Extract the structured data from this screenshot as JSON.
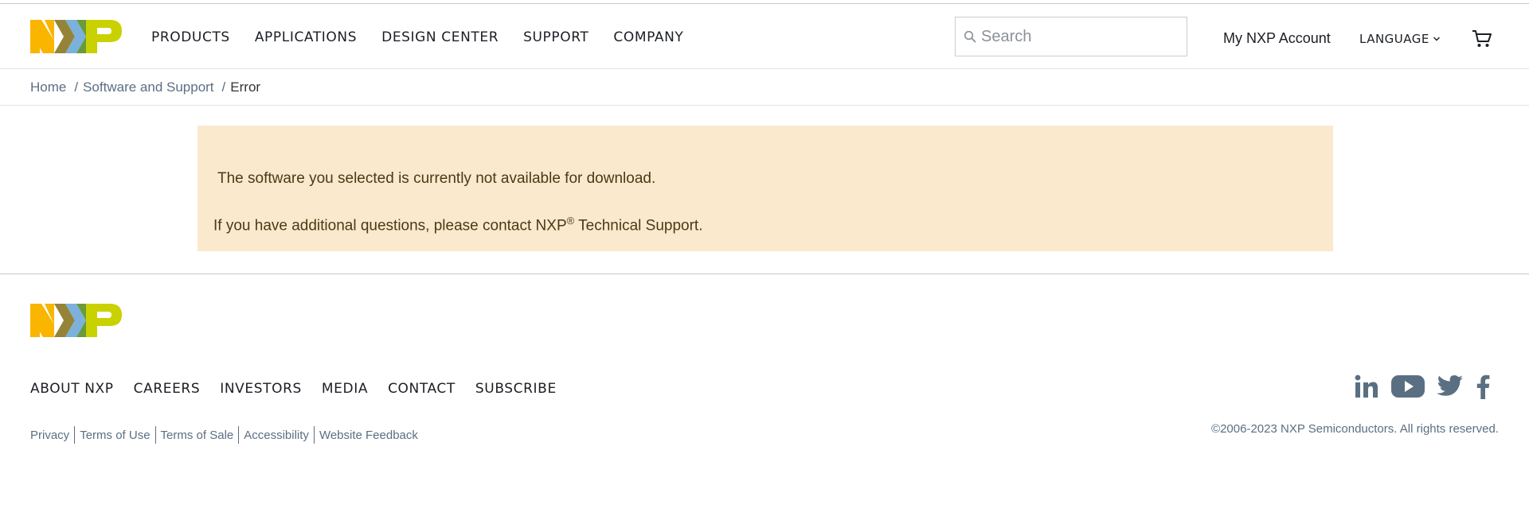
{
  "brand": {
    "logo_text": "NXP",
    "colors": {
      "orange": "#F9B500",
      "blue": "#7BB1DB",
      "green": "#C9D200",
      "dark_olive": "#958437",
      "dark_green": "#6A9A3A"
    }
  },
  "header": {
    "nav": [
      "PRODUCTS",
      "APPLICATIONS",
      "DESIGN CENTER",
      "SUPPORT",
      "COMPANY"
    ],
    "search": {
      "placeholder": "Search",
      "value": ""
    },
    "account_label": "My NXP Account",
    "language_label": "LANGUAGE"
  },
  "breadcrumb": {
    "items": [
      "Home",
      "Software and Support"
    ],
    "separator": "/",
    "current": "Error"
  },
  "alert": {
    "message": "The software you selected is currently not available for download.",
    "contact_prefix": "If you have additional questions, please contact NXP",
    "contact_mark": "®",
    "contact_suffix": " Technical Support.",
    "background": "#fbe9cd"
  },
  "footer": {
    "nav": [
      "ABOUT NXP",
      "CAREERS",
      "INVESTORS",
      "MEDIA",
      "CONTACT",
      "SUBSCRIBE"
    ],
    "legal": [
      "Privacy",
      "Terms of Use",
      "Terms of Sale",
      "Accessibility",
      "Website Feedback"
    ],
    "social": [
      "linkedin-icon",
      "youtube-icon",
      "twitter-icon",
      "facebook-icon"
    ],
    "copyright": "©2006-2023 NXP Semiconductors. All rights reserved."
  }
}
